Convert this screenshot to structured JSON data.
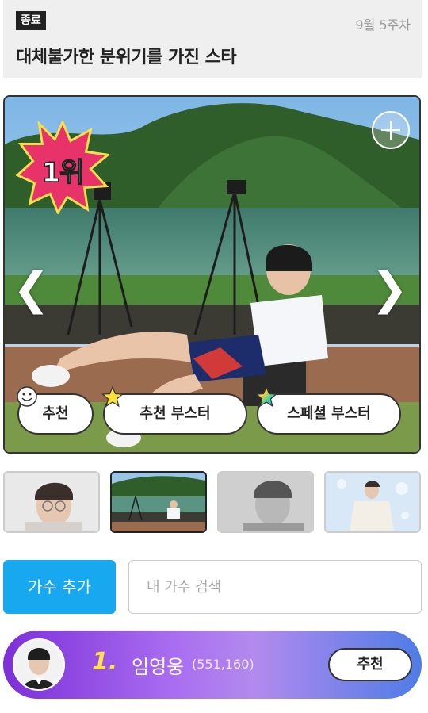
{
  "header": {
    "status_badge": "종료",
    "week": "9월 5주차",
    "title": "대체불가한 분위기를 가진 스타"
  },
  "photo": {
    "rank_label": "1위",
    "prev_arrow": "❮",
    "next_arrow": "❯",
    "buttons": {
      "recommend": "추천",
      "recommend_booster": "추천 부스터",
      "special_booster": "스페셜 부스터"
    }
  },
  "search": {
    "add_singer_label": "가수 추가",
    "placeholder": "내 가수 검색"
  },
  "ranking": {
    "rank": "1.",
    "name": "임영웅",
    "count": "(551,160)",
    "vote_label": "추천"
  },
  "colors": {
    "accent_blue": "#17a8f0",
    "rank_gradient_start": "#7d2fd8",
    "rank_gradient_end": "#4f7ce6",
    "rank_number": "#ffe14a",
    "rank_badge": "#e8336a"
  }
}
